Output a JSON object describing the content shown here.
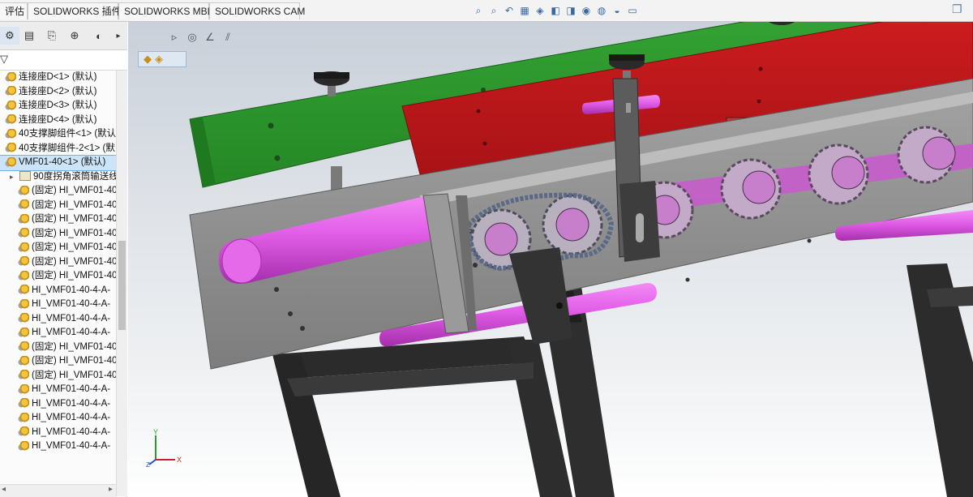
{
  "tabs": [
    {
      "label": "评估"
    },
    {
      "label": "SOLIDWORKS 插件"
    },
    {
      "label": "SOLIDWORKS MBD"
    },
    {
      "label": "SOLIDWORKS CAM"
    }
  ],
  "tree": {
    "items": [
      {
        "label": "连接座D<1> (默认)",
        "icon": "assembly-icon",
        "selected": false,
        "expander": false,
        "indent": 0
      },
      {
        "label": "连接座D<2> (默认)",
        "icon": "assembly-icon",
        "selected": false,
        "expander": false,
        "indent": 0
      },
      {
        "label": "连接座D<3> (默认)",
        "icon": "assembly-icon",
        "selected": false,
        "expander": false,
        "indent": 0
      },
      {
        "label": "连接座D<4> (默认)",
        "icon": "assembly-icon",
        "selected": false,
        "expander": false,
        "indent": 0
      },
      {
        "label": "40支撑脚组件<1> (默认",
        "icon": "assembly-icon",
        "selected": false,
        "expander": false,
        "indent": 0
      },
      {
        "label": "40支撑脚组件-2<1> (默",
        "icon": "assembly-icon",
        "selected": false,
        "expander": false,
        "indent": 0
      },
      {
        "label": "VMF01-40<1> (默认)",
        "icon": "assembly-icon",
        "selected": true,
        "expander": false,
        "indent": 0
      },
      {
        "label": "90度拐角滚筒输送线",
        "icon": "folder-icon",
        "selected": false,
        "expander": true,
        "indent": 1
      },
      {
        "label": "(固定) HI_VMF01-40",
        "icon": "assembly-icon",
        "selected": false,
        "expander": false,
        "indent": 1
      },
      {
        "label": "(固定) HI_VMF01-40",
        "icon": "assembly-icon",
        "selected": false,
        "expander": false,
        "indent": 1
      },
      {
        "label": "(固定) HI_VMF01-40",
        "icon": "assembly-icon",
        "selected": false,
        "expander": false,
        "indent": 1
      },
      {
        "label": "(固定) HI_VMF01-40",
        "icon": "assembly-icon",
        "selected": false,
        "expander": false,
        "indent": 1
      },
      {
        "label": "(固定) HI_VMF01-40",
        "icon": "assembly-icon",
        "selected": false,
        "expander": false,
        "indent": 1
      },
      {
        "label": "(固定) HI_VMF01-40",
        "icon": "assembly-icon",
        "selected": false,
        "expander": false,
        "indent": 1
      },
      {
        "label": "(固定) HI_VMF01-40",
        "icon": "assembly-icon",
        "selected": false,
        "expander": false,
        "indent": 1
      },
      {
        "label": "HI_VMF01-40-4-A-",
        "icon": "assembly-icon",
        "selected": false,
        "expander": false,
        "indent": 1
      },
      {
        "label": "HI_VMF01-40-4-A-",
        "icon": "assembly-icon",
        "selected": false,
        "expander": false,
        "indent": 1
      },
      {
        "label": "HI_VMF01-40-4-A-",
        "icon": "assembly-icon",
        "selected": false,
        "expander": false,
        "indent": 1
      },
      {
        "label": "HI_VMF01-40-4-A-",
        "icon": "assembly-icon",
        "selected": false,
        "expander": false,
        "indent": 1
      },
      {
        "label": "(固定) HI_VMF01-40",
        "icon": "assembly-icon",
        "selected": false,
        "expander": false,
        "indent": 1
      },
      {
        "label": "(固定) HI_VMF01-40",
        "icon": "assembly-icon",
        "selected": false,
        "expander": false,
        "indent": 1
      },
      {
        "label": "(固定) HI_VMF01-40",
        "icon": "assembly-icon",
        "selected": false,
        "expander": false,
        "indent": 1
      },
      {
        "label": "HI_VMF01-40-4-A-",
        "icon": "assembly-icon",
        "selected": false,
        "expander": false,
        "indent": 1
      },
      {
        "label": "HI_VMF01-40-4-A-",
        "icon": "assembly-icon",
        "selected": false,
        "expander": false,
        "indent": 1
      },
      {
        "label": "HI_VMF01-40-4-A-",
        "icon": "assembly-icon",
        "selected": false,
        "expander": false,
        "indent": 1
      },
      {
        "label": "HI_VMF01-40-4-A-",
        "icon": "assembly-icon",
        "selected": false,
        "expander": false,
        "indent": 1
      },
      {
        "label": "HI_VMF01-40-4-A-",
        "icon": "assembly-icon",
        "selected": false,
        "expander": false,
        "indent": 1
      }
    ]
  },
  "panel_tabs": [
    "feature-manager-icon",
    "property-manager-icon",
    "configuration-manager-icon",
    "dimxpert-icon",
    "appearance-icon"
  ],
  "view_icons": [
    "zoom-to-fit-icon",
    "zoom-area-icon",
    "previous-view-icon",
    "section-view-icon",
    "dynamic-annotation-icon",
    "view-orientation-icon",
    "display-style-icon",
    "hide-show-icon",
    "edit-appearance-icon",
    "apply-scene-icon",
    "view-settings-icon"
  ],
  "colors": {
    "selection": "#cce4f7",
    "green_panel": "#2e9a2e",
    "red_panel": "#c0181b",
    "rollers": "#e05ce6",
    "frame": "#8f8f8f",
    "legs": "#2b2b2b"
  },
  "triad": {
    "x": "X",
    "y": "Y",
    "z": "Z"
  }
}
